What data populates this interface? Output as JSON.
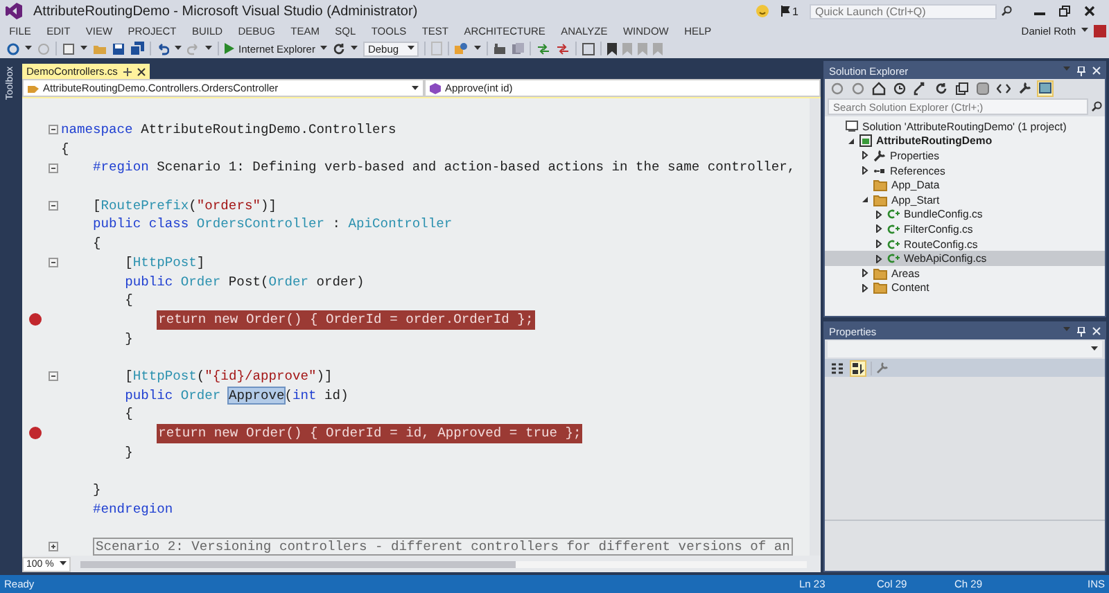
{
  "window": {
    "title": "AttributeRoutingDemo - Microsoft Visual Studio (Administrator)",
    "notification_count": "1",
    "quick_launch": {
      "placeholder": "Quick Launch (Ctrl+Q)"
    },
    "user": "Daniel Roth"
  },
  "menu": [
    "FILE",
    "EDIT",
    "VIEW",
    "PROJECT",
    "BUILD",
    "DEBUG",
    "TEAM",
    "SQL",
    "TOOLS",
    "TEST",
    "ARCHITECTURE",
    "ANALYZE",
    "WINDOW",
    "HELP"
  ],
  "toolbar": {
    "run_target": "Internet Explorer",
    "configuration": "Debug"
  },
  "toolbox": {
    "label": "Toolbox"
  },
  "editor": {
    "tabs": [
      {
        "label": "DemoControllers.cs",
        "selected": true
      }
    ],
    "type_selector": "AttributeRoutingDemo.Controllers.OrdersController",
    "member_selector": "Approve(int id)",
    "lines": [
      {
        "kind": "code",
        "fold": true,
        "segments": [
          {
            "kind": "keyword",
            "text": "namespace"
          },
          {
            "kind": "plain",
            "text": " AttributeRoutingDemo.Controllers"
          }
        ]
      },
      {
        "kind": "code",
        "segments": [
          {
            "kind": "plain",
            "text": "{"
          }
        ],
        "children": [
          {
            "kind": "code",
            "fold": true,
            "segments": [
              {
                "kind": "keyword",
                "text": "#region"
              },
              {
                "kind": "plain",
                "text": " Scenario 1: Defining verb-based and action-based actions in the same controller,"
              }
            ]
          },
          {
            "kind": "blank"
          },
          {
            "kind": "code",
            "fold": true,
            "segments": [
              {
                "kind": "plain",
                "text": "["
              },
              {
                "kind": "type",
                "text": "RoutePrefix"
              },
              {
                "kind": "plain",
                "text": "("
              },
              {
                "kind": "string",
                "text": "\"orders\""
              },
              {
                "kind": "plain",
                "text": ")]"
              }
            ]
          },
          {
            "kind": "code",
            "segments": [
              {
                "kind": "keyword",
                "text": "public"
              },
              {
                "kind": "keyword",
                "text": " class"
              },
              {
                "kind": "type",
                "text": " OrdersController"
              },
              {
                "kind": "plain",
                "text": " : "
              },
              {
                "kind": "type",
                "text": "ApiController"
              }
            ]
          },
          {
            "kind": "code",
            "segments": [
              {
                "kind": "plain",
                "text": "{"
              }
            ],
            "children": [
              {
                "kind": "code",
                "fold": true,
                "segments": [
                  {
                    "kind": "plain",
                    "text": "["
                  },
                  {
                    "kind": "type",
                    "text": "HttpPost"
                  },
                  {
                    "kind": "plain",
                    "text": "]"
                  }
                ]
              },
              {
                "kind": "code",
                "segments": [
                  {
                    "kind": "keyword",
                    "text": "public"
                  },
                  {
                    "kind": "type",
                    "text": " Order"
                  },
                  {
                    "kind": "plain",
                    "text": " Post("
                  },
                  {
                    "kind": "type",
                    "text": "Order"
                  },
                  {
                    "kind": "plain",
                    "text": " order)"
                  }
                ]
              },
              {
                "kind": "code",
                "segments": [
                  {
                    "kind": "plain",
                    "text": "{"
                  }
                ],
                "children": [
                  {
                    "kind": "code",
                    "breakpoint": true,
                    "text": "return new Order() { OrderId = order.OrderId };"
                  }
                ]
              },
              {
                "kind": "code",
                "segments": [
                  {
                    "kind": "plain",
                    "text": "}"
                  }
                ]
              },
              {
                "kind": "blank"
              },
              {
                "kind": "code",
                "fold": true,
                "segments": [
                  {
                    "kind": "plain",
                    "text": "["
                  },
                  {
                    "kind": "type",
                    "text": "HttpPost"
                  },
                  {
                    "kind": "plain",
                    "text": "("
                  },
                  {
                    "kind": "string",
                    "text": "\"{id}/approve\""
                  },
                  {
                    "kind": "plain",
                    "text": ")]"
                  }
                ]
              },
              {
                "kind": "code",
                "segments": [
                  {
                    "kind": "keyword",
                    "text": "public"
                  },
                  {
                    "kind": "type",
                    "text": " Order "
                  },
                  {
                    "kind": "selection",
                    "text": "Approve"
                  },
                  {
                    "kind": "plain",
                    "text": "("
                  },
                  {
                    "kind": "keyword",
                    "text": "int"
                  },
                  {
                    "kind": "plain",
                    "text": " id)"
                  }
                ]
              },
              {
                "kind": "code",
                "segments": [
                  {
                    "kind": "plain",
                    "text": "{"
                  }
                ],
                "children": [
                  {
                    "kind": "code",
                    "breakpoint": true,
                    "text": "return new Order() { OrderId = id, Approved = true };"
                  }
                ]
              },
              {
                "kind": "code",
                "segments": [
                  {
                    "kind": "plain",
                    "text": "}"
                  }
                ]
              },
              {
                "kind": "blank"
              }
            ]
          },
          {
            "kind": "code",
            "segments": [
              {
                "kind": "plain",
                "text": "}"
              }
            ]
          },
          {
            "kind": "code",
            "segments": [
              {
                "kind": "keyword",
                "text": "#endregion"
              }
            ]
          },
          {
            "kind": "blank"
          },
          {
            "kind": "collapsed",
            "fold": true,
            "segments": [
              {
                "kind": "plain",
                "text": "Scenario 2: Versioning controllers - different controllers for different versions of an"
              }
            ]
          }
        ]
      }
    ],
    "zoom": "100 %"
  },
  "solution_explorer": {
    "title": "Solution Explorer",
    "toolbar": [
      {
        "kind": "back",
        "selected": false
      },
      {
        "kind": "forward",
        "selected": false
      },
      {
        "kind": "home",
        "selected": false
      },
      {
        "kind": "pending",
        "selected": false
      },
      {
        "kind": "sync",
        "selected": false
      },
      {
        "kind": "refresh",
        "selected": false
      },
      {
        "kind": "collapse",
        "selected": false
      },
      {
        "kind": "show_all",
        "selected": false
      },
      {
        "kind": "code",
        "selected": false
      },
      {
        "kind": "properties",
        "selected": false
      },
      {
        "kind": "preview",
        "selected": true
      }
    ],
    "search": {
      "placeholder": "Search Solution Explorer (Ctrl+;)"
    },
    "tree": [
      {
        "label": "Solution 'AttributeRoutingDemo' (1 project)",
        "kind": "solution",
        "selected": false,
        "children": [
          {
            "label": "AttributeRoutingDemo",
            "kind": "project",
            "expanded": true,
            "selected": false,
            "children": [
              {
                "label": "Properties",
                "kind": "properties",
                "expanded": false,
                "selected": false
              },
              {
                "label": "References",
                "kind": "references",
                "expanded": false,
                "selected": false
              },
              {
                "label": "App_Data",
                "kind": "folder",
                "selected": false
              },
              {
                "label": "App_Start",
                "kind": "folder",
                "expanded": true,
                "selected": false,
                "children": [
                  {
                    "label": "BundleConfig.cs",
                    "kind": "cs",
                    "expanded": false,
                    "selected": false
                  },
                  {
                    "label": "FilterConfig.cs",
                    "kind": "cs",
                    "expanded": false,
                    "selected": false
                  },
                  {
                    "label": "RouteConfig.cs",
                    "kind": "cs",
                    "expanded": false,
                    "selected": false
                  },
                  {
                    "label": "WebApiConfig.cs",
                    "kind": "cs",
                    "expanded": false,
                    "selected": true
                  }
                ]
              },
              {
                "label": "Areas",
                "kind": "folder",
                "expanded": false,
                "selected": false
              },
              {
                "label": "Content",
                "kind": "folder",
                "expanded": false,
                "selected": false
              }
            ]
          }
        ]
      }
    ]
  },
  "properties": {
    "title": "Properties",
    "toolbar": [
      {
        "kind": "categorized",
        "selected": false
      },
      {
        "kind": "alphabetical",
        "selected": true
      }
    ]
  },
  "status_bar": {
    "message": "Ready",
    "line": "Ln 23",
    "column": "Col 29",
    "char": "Ch 29",
    "mode": "INS"
  }
}
